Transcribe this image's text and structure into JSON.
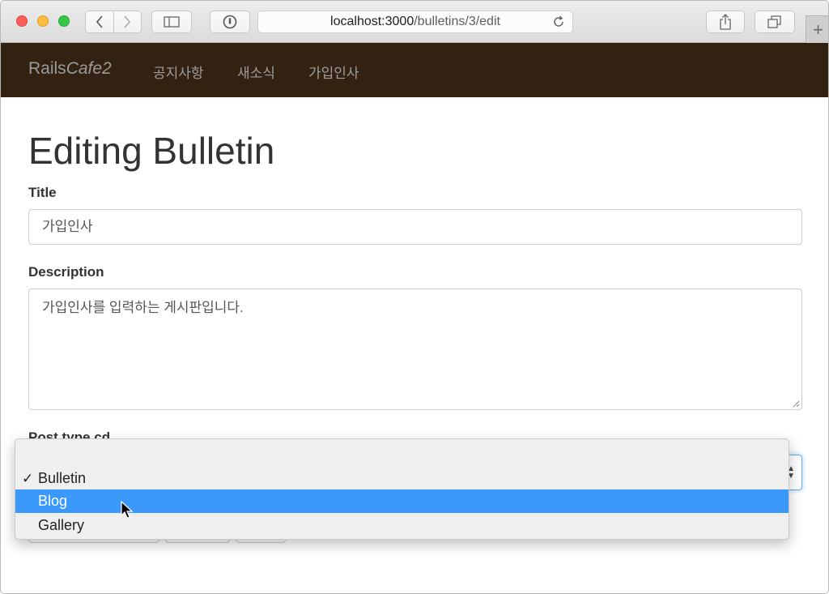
{
  "browser": {
    "url_host": "localhost:3000",
    "url_path": "/bulletins/3/edit"
  },
  "navbar": {
    "brand_plain": "Rails",
    "brand_italic": "Cafe2",
    "links": [
      "공지사항",
      "새소식",
      "가입인사"
    ]
  },
  "page": {
    "heading": "Editing Bulletin",
    "title_label": "Title",
    "title_value": "가입인사",
    "description_label": "Description",
    "description_value": "가입인사를 입력하는 게시판입니다.",
    "post_type_label": "Post type cd"
  },
  "dropdown": {
    "options": [
      "Bulletin",
      "Blog",
      "Gallery"
    ],
    "checked": "Bulletin",
    "highlighted": "Blog",
    "check_glyph": "✓"
  },
  "colors": {
    "navbar_bg": "#332212",
    "highlight": "#3b99fc"
  }
}
